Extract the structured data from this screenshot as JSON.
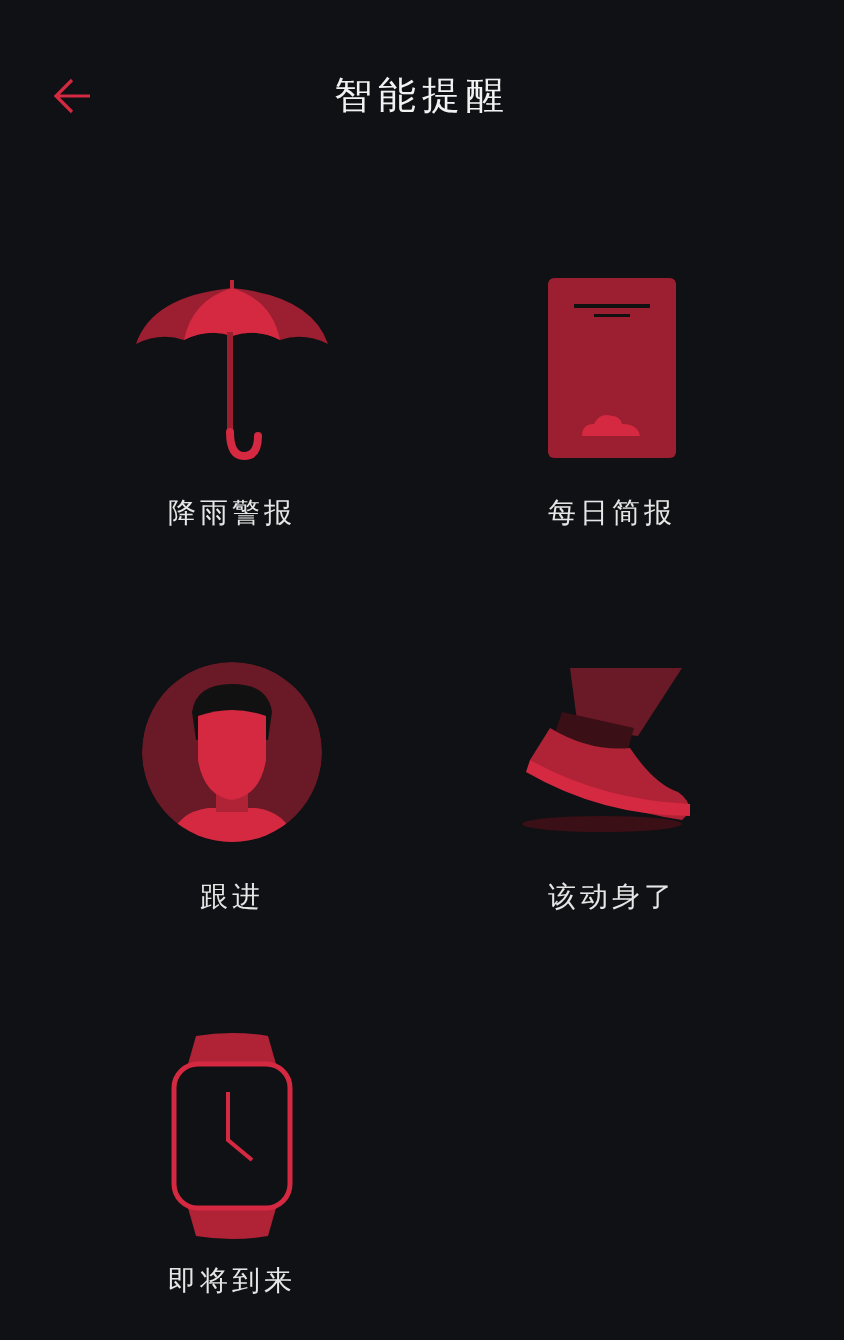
{
  "header": {
    "title": "智能提醒"
  },
  "items": [
    {
      "kind": "umbrella",
      "label": "降雨警报"
    },
    {
      "kind": "report",
      "label": "每日简报"
    },
    {
      "kind": "person",
      "label": "跟进"
    },
    {
      "kind": "shoe",
      "label": "该动身了"
    },
    {
      "kind": "watch",
      "label": "即将到来"
    }
  ]
}
